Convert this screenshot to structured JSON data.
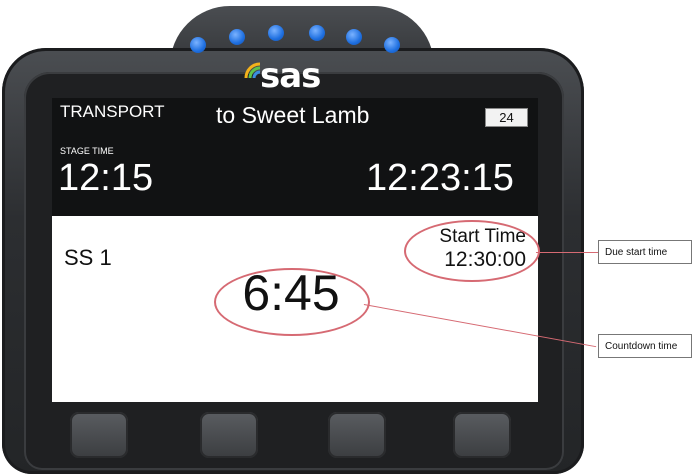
{
  "device": {
    "logo_text": "sas",
    "leds": 6,
    "led_color": "#1e6fe0",
    "icon": "signal-waves-icon"
  },
  "header": {
    "mode": "TRANSPORT",
    "destination": "to Sweet Lamb",
    "badge": "24"
  },
  "times": {
    "stage_time_label": "STAGE TIME",
    "stage_time": "12:15",
    "clock_time": "12:23:15"
  },
  "stage": {
    "name": "SS 1",
    "start_time_label": "Start Time",
    "start_time": "12:30:00",
    "countdown": "6:45"
  },
  "callouts": {
    "due_start": "Due start time",
    "countdown": "Countdown time",
    "color": "#d66a73"
  },
  "softkeys": [
    "",
    "",
    "",
    ""
  ]
}
